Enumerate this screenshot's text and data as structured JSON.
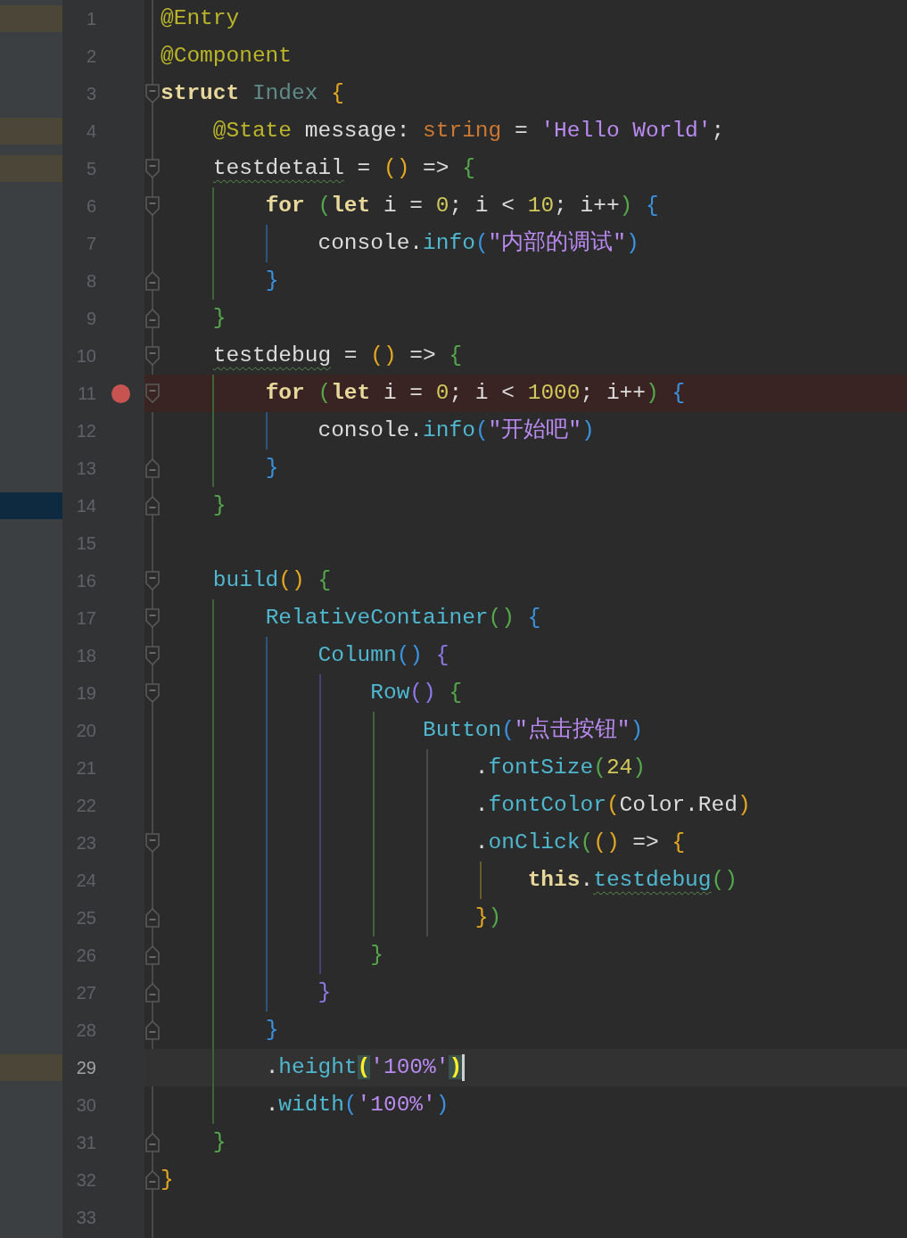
{
  "editor": {
    "lines": [
      {
        "number": "1",
        "modified": true,
        "tokens": [
          {
            "kind": "decorator",
            "text": "@Entry"
          }
        ]
      },
      {
        "number": "2",
        "tokens": [
          {
            "kind": "decorator",
            "text": "@Component"
          }
        ]
      },
      {
        "number": "3",
        "fold_start": true,
        "tokens": [
          {
            "kind": "keyword",
            "text": "struct"
          },
          {
            "kind": "type",
            "text": " Index"
          },
          {
            "kind": "brace1",
            "text": " {"
          }
        ]
      },
      {
        "number": "4",
        "modified": true,
        "tokens": [
          {
            "kind": "decorator",
            "text": "    @State"
          },
          {
            "kind": "plain",
            "text": " message:"
          },
          {
            "kind": "typename",
            "text": " string"
          },
          {
            "kind": "plain",
            "text": " ="
          },
          {
            "kind": "string",
            "text": " 'Hello World'"
          },
          {
            "kind": "plain",
            "text": ";"
          }
        ]
      },
      {
        "number": "5",
        "modified": true,
        "fold_start": true,
        "tokens": [
          {
            "kind": "plain",
            "text": "    testdetail",
            "warning": true
          },
          {
            "kind": "plain",
            "text": " ="
          },
          {
            "kind": "brace1",
            "text": " ()"
          },
          {
            "kind": "plain",
            "text": " =>"
          },
          {
            "kind": "brace2",
            "text": " {"
          }
        ]
      },
      {
        "number": "6",
        "fold_start": true,
        "tokens": [
          {
            "kind": "keyword",
            "text": "        for"
          },
          {
            "kind": "brace2",
            "text": " ("
          },
          {
            "kind": "keyword",
            "text": "let"
          },
          {
            "kind": "plain",
            "text": " i ="
          },
          {
            "kind": "number",
            "text": " 0"
          },
          {
            "kind": "plain",
            "text": "; i <"
          },
          {
            "kind": "number",
            "text": " 10"
          },
          {
            "kind": "plain",
            "text": "; i++"
          },
          {
            "kind": "brace2",
            "text": ")"
          },
          {
            "kind": "brace3",
            "text": " {"
          }
        ]
      },
      {
        "number": "7",
        "tokens": [
          {
            "kind": "plain",
            "text": "            console."
          },
          {
            "kind": "function",
            "text": "info"
          },
          {
            "kind": "brace3",
            "text": "("
          },
          {
            "kind": "string",
            "text": "\"内部的调试\""
          },
          {
            "kind": "brace3",
            "text": ")"
          }
        ]
      },
      {
        "number": "8",
        "fold_end": true,
        "tokens": [
          {
            "kind": "brace3",
            "text": "        }"
          }
        ]
      },
      {
        "number": "9",
        "fold_end": true,
        "tokens": [
          {
            "kind": "brace2",
            "text": "    }"
          }
        ]
      },
      {
        "number": "10",
        "fold_start": true,
        "tokens": [
          {
            "kind": "plain",
            "text": "    testdebug",
            "warning": true
          },
          {
            "kind": "plain",
            "text": " ="
          },
          {
            "kind": "brace1",
            "text": " ()"
          },
          {
            "kind": "plain",
            "text": " =>"
          },
          {
            "kind": "brace2",
            "text": " {"
          }
        ]
      },
      {
        "number": "11",
        "breakpoint": true,
        "fold_start": true,
        "tokens": [
          {
            "kind": "keyword",
            "text": "        for"
          },
          {
            "kind": "brace2",
            "text": " ("
          },
          {
            "kind": "keyword",
            "text": "let"
          },
          {
            "kind": "plain",
            "text": " i ="
          },
          {
            "kind": "number",
            "text": " 0"
          },
          {
            "kind": "plain",
            "text": "; i <"
          },
          {
            "kind": "number",
            "text": " 1000"
          },
          {
            "kind": "plain",
            "text": "; i++"
          },
          {
            "kind": "brace2",
            "text": ")"
          },
          {
            "kind": "brace3",
            "text": " {"
          }
        ]
      },
      {
        "number": "12",
        "tokens": [
          {
            "kind": "plain",
            "text": "            console."
          },
          {
            "kind": "function",
            "text": "info"
          },
          {
            "kind": "brace3",
            "text": "("
          },
          {
            "kind": "string",
            "text": "\"开始吧\""
          },
          {
            "kind": "brace3",
            "text": ")"
          }
        ]
      },
      {
        "number": "13",
        "fold_end": true,
        "tokens": [
          {
            "kind": "brace3",
            "text": "        }"
          }
        ]
      },
      {
        "number": "14",
        "added": true,
        "fold_end": true,
        "tokens": [
          {
            "kind": "brace2",
            "text": "    }"
          }
        ]
      },
      {
        "number": "15"
      },
      {
        "number": "16",
        "fold_start": true,
        "tokens": [
          {
            "kind": "function",
            "text": "    build"
          },
          {
            "kind": "brace1",
            "text": "()"
          },
          {
            "kind": "brace2",
            "text": " {"
          }
        ]
      },
      {
        "number": "17",
        "fold_start": true,
        "tokens": [
          {
            "kind": "function",
            "text": "        RelativeContainer"
          },
          {
            "kind": "brace2",
            "text": "()"
          },
          {
            "kind": "brace3",
            "text": " {"
          }
        ]
      },
      {
        "number": "18",
        "fold_start": true,
        "tokens": [
          {
            "kind": "function",
            "text": "            Column"
          },
          {
            "kind": "brace3",
            "text": "()"
          },
          {
            "kind": "brace4",
            "text": " {"
          }
        ]
      },
      {
        "number": "19",
        "fold_start": true,
        "tokens": [
          {
            "kind": "function",
            "text": "                Row"
          },
          {
            "kind": "brace4",
            "text": "()"
          },
          {
            "kind": "brace2",
            "text": " {"
          }
        ]
      },
      {
        "number": "20",
        "tokens": [
          {
            "kind": "function",
            "text": "                    Button"
          },
          {
            "kind": "brace3",
            "text": "("
          },
          {
            "kind": "string",
            "text": "\"点击按钮\""
          },
          {
            "kind": "brace3",
            "text": ")"
          }
        ]
      },
      {
        "number": "21",
        "tokens": [
          {
            "kind": "plain",
            "text": "                        ."
          },
          {
            "kind": "function",
            "text": "fontSize"
          },
          {
            "kind": "brace2",
            "text": "("
          },
          {
            "kind": "number",
            "text": "24"
          },
          {
            "kind": "brace2",
            "text": ")"
          }
        ]
      },
      {
        "number": "22",
        "tokens": [
          {
            "kind": "plain",
            "text": "                        ."
          },
          {
            "kind": "function",
            "text": "fontColor"
          },
          {
            "kind": "brace1",
            "text": "("
          },
          {
            "kind": "plain",
            "text": "Color.Red"
          },
          {
            "kind": "brace1",
            "text": ")"
          }
        ]
      },
      {
        "number": "23",
        "fold_start": true,
        "tokens": [
          {
            "kind": "plain",
            "text": "                        ."
          },
          {
            "kind": "function",
            "text": "onClick"
          },
          {
            "kind": "brace2",
            "text": "("
          },
          {
            "kind": "brace1",
            "text": "()"
          },
          {
            "kind": "plain",
            "text": " =>"
          },
          {
            "kind": "brace1",
            "text": " {"
          }
        ]
      },
      {
        "number": "24",
        "tokens": [
          {
            "kind": "keyword",
            "text": "                            this"
          },
          {
            "kind": "plain",
            "text": "."
          },
          {
            "kind": "function",
            "text": "testdebug",
            "warning": true
          },
          {
            "kind": "brace2",
            "text": "()"
          }
        ]
      },
      {
        "number": "25",
        "fold_end": true,
        "tokens": [
          {
            "kind": "brace1",
            "text": "                        }"
          },
          {
            "kind": "brace2",
            "text": ")"
          }
        ]
      },
      {
        "number": "26",
        "fold_end": true,
        "tokens": [
          {
            "kind": "brace2",
            "text": "                }"
          }
        ]
      },
      {
        "number": "27",
        "fold_end": true,
        "tokens": [
          {
            "kind": "brace4",
            "text": "            }"
          }
        ]
      },
      {
        "number": "28",
        "fold_end": true,
        "tokens": [
          {
            "kind": "brace3",
            "text": "        }"
          }
        ]
      },
      {
        "number": "29",
        "modified": true,
        "current": true,
        "tokens": [
          {
            "kind": "plain",
            "text": "        ."
          },
          {
            "kind": "function",
            "text": "height"
          },
          {
            "kind": "brace1",
            "text": "(",
            "matched": true
          },
          {
            "kind": "string",
            "text": "'100%'"
          },
          {
            "kind": "brace1",
            "text": ")",
            "matched": true
          }
        ]
      },
      {
        "number": "30",
        "tokens": [
          {
            "kind": "plain",
            "text": "        ."
          },
          {
            "kind": "function",
            "text": "width"
          },
          {
            "kind": "brace3",
            "text": "("
          },
          {
            "kind": "string",
            "text": "'100%'"
          },
          {
            "kind": "brace3",
            "text": ")"
          }
        ]
      },
      {
        "number": "31",
        "fold_end": true,
        "tokens": [
          {
            "kind": "brace2",
            "text": "    }"
          }
        ]
      },
      {
        "number": "32",
        "fold_end": true,
        "tokens": [
          {
            "kind": "brace1",
            "text": "}"
          }
        ]
      },
      {
        "number": "33"
      }
    ]
  }
}
